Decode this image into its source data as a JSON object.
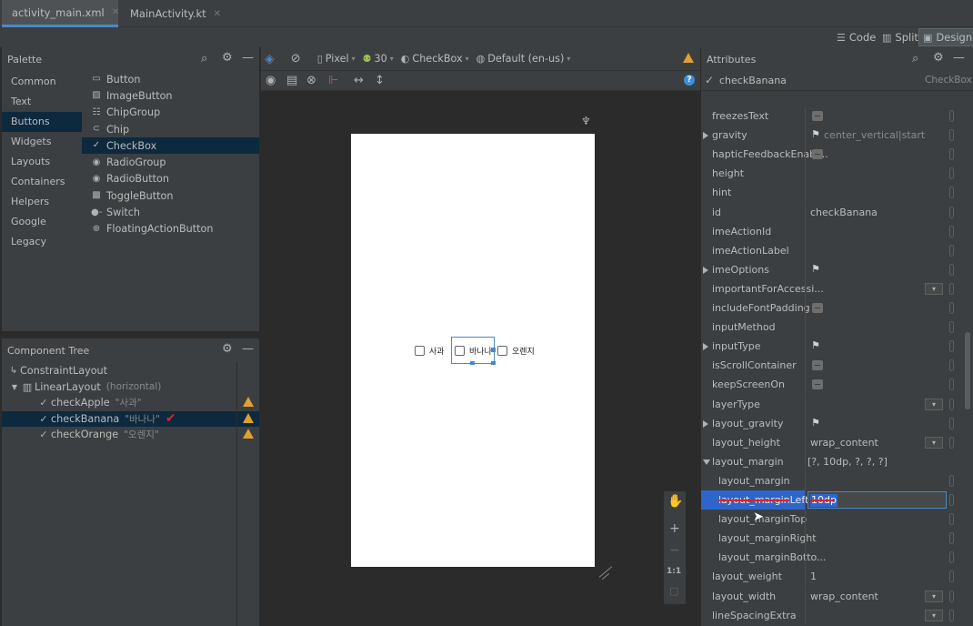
{
  "tabs": [
    {
      "label": "activity_main.xml",
      "active": true
    },
    {
      "label": "MainActivity.kt",
      "active": false
    }
  ],
  "view_modes": [
    "Code",
    "Split",
    "Design"
  ],
  "view_mode_selected": "Design",
  "palette": {
    "title": "Palette",
    "categories": [
      "Common",
      "Text",
      "Buttons",
      "Widgets",
      "Layouts",
      "Containers",
      "Helpers",
      "Google",
      "Legacy"
    ],
    "selected_category": "Buttons",
    "items": [
      "Button",
      "ImageButton",
      "ChipGroup",
      "Chip",
      "CheckBox",
      "RadioGroup",
      "RadioButton",
      "ToggleButton",
      "Switch",
      "FloatingActionButton"
    ],
    "selected_item": "CheckBox"
  },
  "component_tree": {
    "title": "Component Tree",
    "nodes": [
      {
        "name": "ConstraintLayout",
        "hint": "",
        "level": 0
      },
      {
        "name": "LinearLayout",
        "hint": "(horizontal)",
        "level": 1
      },
      {
        "name": "checkApple",
        "hint": "\"사과\"",
        "level": 2
      },
      {
        "name": "checkBanana",
        "hint": "\"바나나\"",
        "level": 2
      },
      {
        "name": "checkOrange",
        "hint": "\"오렌지\"",
        "level": 2
      }
    ]
  },
  "design_toolbar": {
    "device": "Pixel",
    "api": "30",
    "theme": "CheckBox",
    "locale": "Default (en-us)"
  },
  "preview": {
    "checkboxes": [
      "사과",
      "바나나",
      "오렌지"
    ]
  },
  "zoom_controls": {
    "one_to_one": "1:1"
  },
  "attributes": {
    "title": "Attributes",
    "component_id": "checkBanana",
    "component_type": "CheckBox",
    "rows": [
      {
        "name": "freezesText",
        "value": "",
        "widget": "toggle"
      },
      {
        "name": "gravity",
        "value": "center_vertical|start",
        "widget": "flag",
        "expandable": true
      },
      {
        "name": "hapticFeedbackEnabl...",
        "value": "",
        "widget": "toggle"
      },
      {
        "name": "height",
        "value": "",
        "widget": "none"
      },
      {
        "name": "hint",
        "value": "",
        "widget": "none"
      },
      {
        "name": "id",
        "value": "checkBanana",
        "widget": "none"
      },
      {
        "name": "imeActionId",
        "value": "",
        "widget": "none"
      },
      {
        "name": "imeActionLabel",
        "value": "",
        "widget": "none"
      },
      {
        "name": "imeOptions",
        "value": "",
        "widget": "flag",
        "expandable": true
      },
      {
        "name": "importantForAccessi...",
        "value": "",
        "widget": "dropdown"
      },
      {
        "name": "includeFontPadding",
        "value": "",
        "widget": "toggle"
      },
      {
        "name": "inputMethod",
        "value": "",
        "widget": "none"
      },
      {
        "name": "inputType",
        "value": "",
        "widget": "flag",
        "expandable": true
      },
      {
        "name": "isScrollContainer",
        "value": "",
        "widget": "toggle"
      },
      {
        "name": "keepScreenOn",
        "value": "",
        "widget": "toggle"
      },
      {
        "name": "layerType",
        "value": "",
        "widget": "dropdown"
      },
      {
        "name": "layout_gravity",
        "value": "",
        "widget": "flag",
        "expandable": true
      },
      {
        "name": "layout_height",
        "value": "wrap_content",
        "widget": "dropdown"
      },
      {
        "name": "layout_margin",
        "value": "[?, 10dp, ?, ?, ?]",
        "widget": "none",
        "expanded": true
      },
      {
        "name": "layout_margin",
        "value": "",
        "widget": "none",
        "indent": true
      },
      {
        "name": "layout_marginLeft",
        "value": "10dp",
        "widget": "edit",
        "indent": true,
        "selected": true
      },
      {
        "name": "layout_marginTop",
        "value": "",
        "widget": "none",
        "indent": true
      },
      {
        "name": "layout_marginRight",
        "value": "",
        "widget": "none",
        "indent": true
      },
      {
        "name": "layout_marginBotto...",
        "value": "",
        "widget": "none",
        "indent": true
      },
      {
        "name": "layout_weight",
        "value": "1",
        "widget": "none"
      },
      {
        "name": "layout_width",
        "value": "wrap_content",
        "widget": "dropdown"
      },
      {
        "name": "lineSpacingExtra",
        "value": "",
        "widget": "dropdown"
      }
    ]
  },
  "colors": {
    "accent": "#4a88c7",
    "selection": "#0d293e",
    "warning": "#e0a030",
    "red_mark": "#e0202a"
  }
}
